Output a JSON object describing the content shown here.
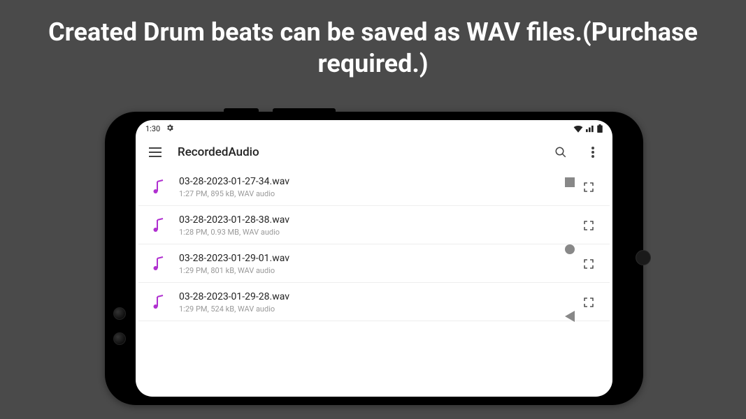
{
  "caption": "Created Drum beats can be saved as WAV files.(Purchase required.)",
  "status": {
    "time": "1:30"
  },
  "appbar": {
    "title": "RecordedAudio"
  },
  "files": [
    {
      "name": "03-28-2023-01-27-34.wav",
      "meta": "1:27 PM, 895 kB, WAV audio"
    },
    {
      "name": "03-28-2023-01-28-38.wav",
      "meta": "1:28 PM, 0.93 MB, WAV audio"
    },
    {
      "name": "03-28-2023-01-29-01.wav",
      "meta": "1:29 PM, 801 kB, WAV audio"
    },
    {
      "name": "03-28-2023-01-29-28.wav",
      "meta": "1:29 PM, 524 kB, WAV audio"
    }
  ]
}
